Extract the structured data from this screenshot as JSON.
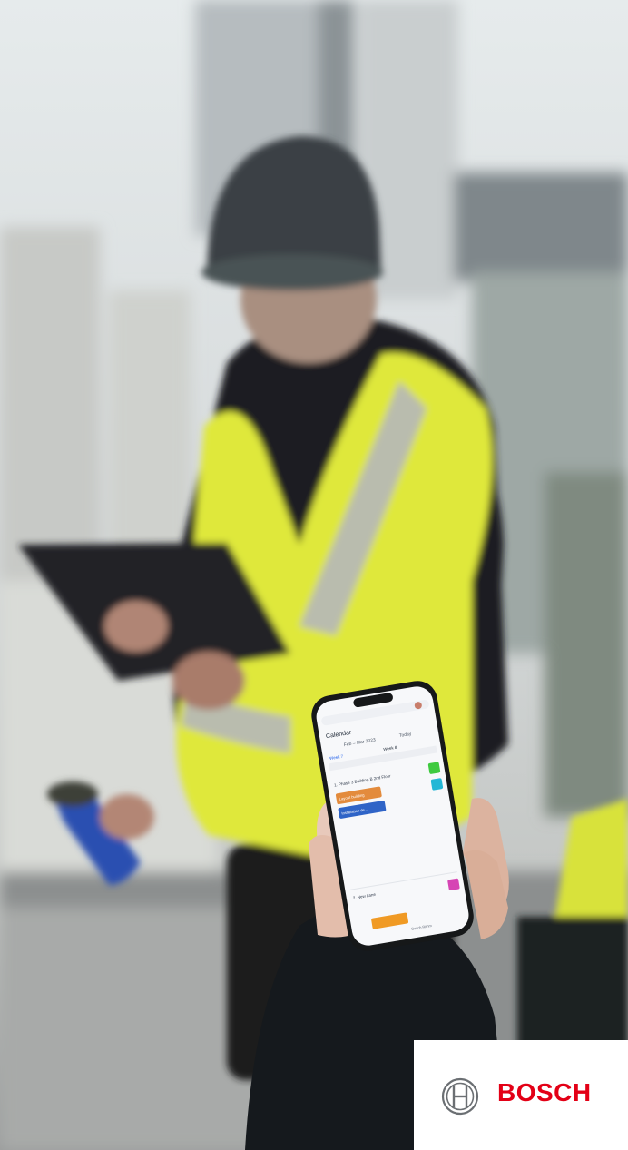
{
  "photo": {
    "subject": "construction-worker-and-phone",
    "colors": {
      "vest": "#dfe83a",
      "reflective": "#b9bcae",
      "jacket": "#1d1f21",
      "helmet": "#3b4144",
      "sleeve": "#15191d",
      "brand": "#e30016"
    }
  },
  "phone": {
    "app_title": "Calendar",
    "date_range": "Feb – Mar 2023",
    "today_label": "Today",
    "week_labels": [
      "Week 7",
      "Week 8"
    ],
    "section_title": "1. Phase 3 Building B 2nd Floor",
    "tasks": [
      "Layout building",
      "Installation de..."
    ],
    "lane_label": "2. New Lane",
    "footer_url": "Bosch Rithm"
  },
  "logo": {
    "brand_name": "BOSCH",
    "mark": "bosch-armature-icon"
  }
}
